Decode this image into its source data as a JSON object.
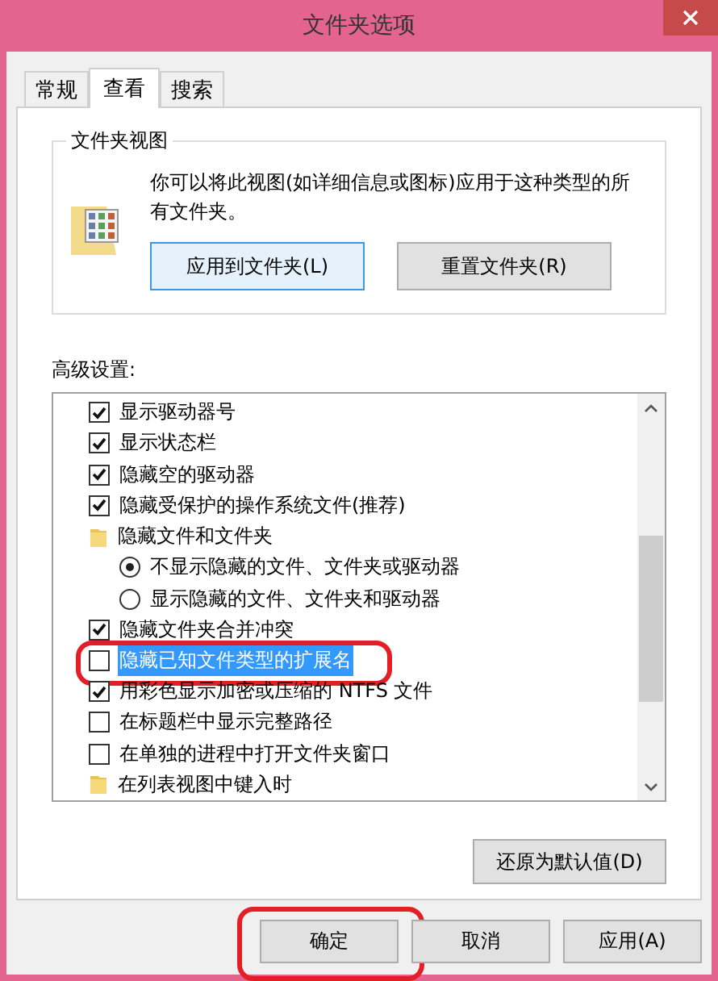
{
  "window": {
    "title": "文件夹选项"
  },
  "tabs": [
    {
      "label": "常规",
      "selected": false
    },
    {
      "label": "查看",
      "selected": true
    },
    {
      "label": "搜索",
      "selected": false
    }
  ],
  "folder_views": {
    "title": "文件夹视图",
    "description": "你可以将此视图(如详细信息或图标)应用于这种类型的所有文件夹。",
    "buttons": [
      {
        "label": "应用到文件夹(L)",
        "focused": true
      },
      {
        "label": "重置文件夹(R)",
        "focused": false
      }
    ]
  },
  "advanced": {
    "label": "高级设置:",
    "items": [
      {
        "kind": "checkbox",
        "label": "显示驱动器号",
        "checked": true,
        "selected": false,
        "highlighted": false
      },
      {
        "kind": "checkbox",
        "label": "显示状态栏",
        "checked": true,
        "selected": false,
        "highlighted": false
      },
      {
        "kind": "checkbox",
        "label": "隐藏空的驱动器",
        "checked": true,
        "selected": false,
        "highlighted": false
      },
      {
        "kind": "checkbox",
        "label": "隐藏受保护的操作系统文件(推荐)",
        "checked": true,
        "selected": false,
        "highlighted": false
      },
      {
        "kind": "folder",
        "label": "隐藏文件和文件夹",
        "children": [
          {
            "kind": "radio",
            "label": "不显示隐藏的文件、文件夹或驱动器",
            "checked": true
          },
          {
            "kind": "radio",
            "label": "显示隐藏的文件、文件夹和驱动器",
            "checked": false
          }
        ]
      },
      {
        "kind": "checkbox",
        "label": "隐藏文件夹合并冲突",
        "checked": true,
        "selected": false,
        "highlighted": false
      },
      {
        "kind": "checkbox",
        "label": "隐藏已知文件类型的扩展名",
        "checked": false,
        "selected": true,
        "highlighted": true
      },
      {
        "kind": "checkbox",
        "label": "用彩色显示加密或压缩的 NTFS 文件",
        "checked": true,
        "selected": false,
        "highlighted": false
      },
      {
        "kind": "checkbox",
        "label": "在标题栏中显示完整路径",
        "checked": false,
        "selected": false,
        "highlighted": false
      },
      {
        "kind": "checkbox",
        "label": "在单独的进程中打开文件夹窗口",
        "checked": false,
        "selected": false,
        "highlighted": false
      },
      {
        "kind": "folder",
        "label": "在列表视图中键入时"
      }
    ],
    "restore_button": "还原为默认值(D)"
  },
  "buttons": [
    {
      "label": "确定",
      "highlighted": true
    },
    {
      "label": "取消",
      "highlighted": false
    },
    {
      "label": "应用(A)",
      "highlighted": false
    }
  ]
}
